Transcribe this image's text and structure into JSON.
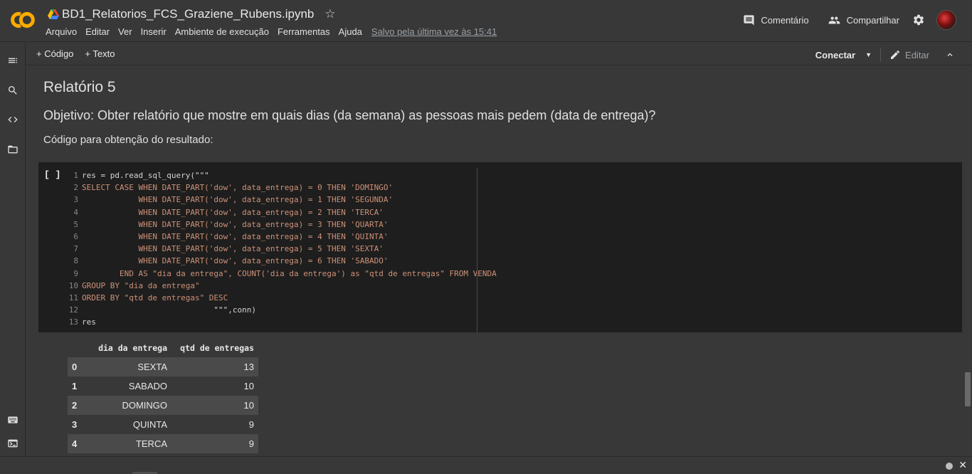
{
  "app": {
    "title": "BD1_Relatorios_FCS_Graziene_Rubens.ipynb",
    "menu": [
      "Arquivo",
      "Editar",
      "Ver",
      "Inserir",
      "Ambiente de execução",
      "Ferramentas",
      "Ajuda"
    ],
    "saved_status": "Salvo pela última vez às 15:41",
    "comment_label": "Comentário",
    "share_label": "Compartilhar"
  },
  "toolbar": {
    "add_code": "+ Código",
    "add_text": "+ Texto",
    "connect": "Conectar",
    "edit": "Editar"
  },
  "content": {
    "heading": "Relatório 5",
    "objective": "Objetivo: Obter relatório que mostre em quais dias (da semana) as pessoas mais pedem (data de entrega)?",
    "code_intro": "Código para obtenção do resultado:"
  },
  "cell": {
    "run_label": "[ ]",
    "lines": [
      {
        "n": "1",
        "text": "res = pd.read_sql_query(\"\"\"",
        "kind": "py"
      },
      {
        "n": "2",
        "text": "SELECT CASE WHEN DATE_PART('dow', data_entrega) = 0 THEN 'DOMINGO'",
        "kind": "str"
      },
      {
        "n": "3",
        "text": "            WHEN DATE_PART('dow', data_entrega) = 1 THEN 'SEGUNDA'",
        "kind": "str"
      },
      {
        "n": "4",
        "text": "            WHEN DATE_PART('dow', data_entrega) = 2 THEN 'TERCA'",
        "kind": "str"
      },
      {
        "n": "5",
        "text": "            WHEN DATE_PART('dow', data_entrega) = 3 THEN 'QUARTA'",
        "kind": "str"
      },
      {
        "n": "6",
        "text": "            WHEN DATE_PART('dow', data_entrega) = 4 THEN 'QUINTA'",
        "kind": "str"
      },
      {
        "n": "7",
        "text": "            WHEN DATE_PART('dow', data_entrega) = 5 THEN 'SEXTA'",
        "kind": "str"
      },
      {
        "n": "8",
        "text": "            WHEN DATE_PART('dow', data_entrega) = 6 THEN 'SABADO'",
        "kind": "str"
      },
      {
        "n": "9",
        "text": "        END AS \"dia da entrega\", COUNT('dia da entrega') as \"qtd de entregas\" FROM VENDA",
        "kind": "str"
      },
      {
        "n": "10",
        "text": "GROUP BY \"dia da entrega\"",
        "kind": "str"
      },
      {
        "n": "11",
        "text": "ORDER BY \"qtd de entregas\" DESC",
        "kind": "str"
      },
      {
        "n": "12",
        "text": "                            \"\"\",conn)",
        "kind": "py"
      },
      {
        "n": "13",
        "text": "res",
        "kind": "py"
      }
    ]
  },
  "output": {
    "columns": [
      "dia da entrega",
      "qtd de entregas"
    ],
    "rows": [
      {
        "idx": "0",
        "dia": "SEXTA",
        "qtd": "13"
      },
      {
        "idx": "1",
        "dia": "SABADO",
        "qtd": "10"
      },
      {
        "idx": "2",
        "dia": "DOMINGO",
        "qtd": "10"
      },
      {
        "idx": "3",
        "dia": "QUINTA",
        "qtd": "9"
      },
      {
        "idx": "4",
        "dia": "TERCA",
        "qtd": "9"
      }
    ]
  },
  "icons": {
    "rail": [
      "table-of-contents-icon",
      "search-icon",
      "code-snippets-icon",
      "files-icon",
      "command-palette-icon",
      "terminal-icon"
    ]
  },
  "colors": {
    "background": "#383838",
    "cell_background": "#1e1e1e",
    "string_color": "#ce9178",
    "logo_orange": "#f9ab00"
  }
}
